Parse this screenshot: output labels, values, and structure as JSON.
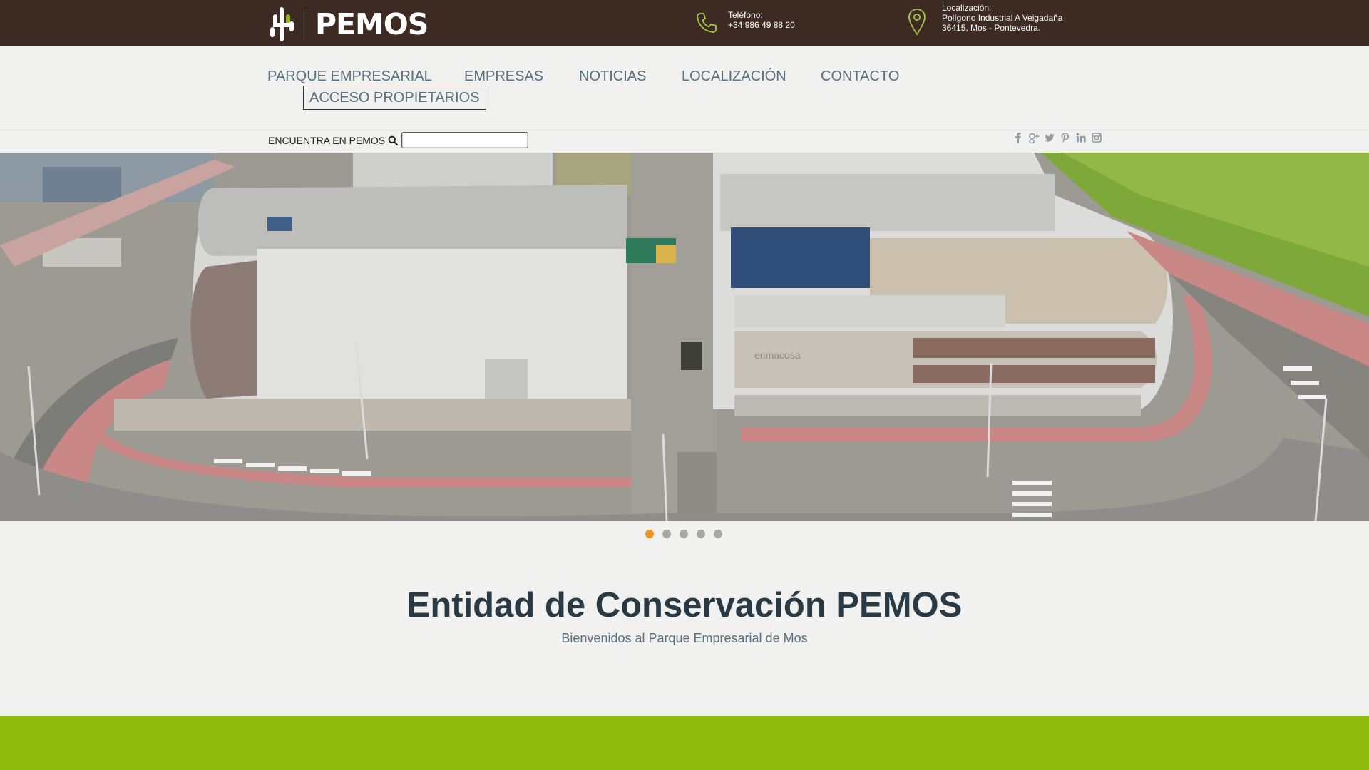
{
  "header": {
    "brand": "PEMOS",
    "phone_label": "Teléfono:",
    "phone_number": "+34 986 49 88 20",
    "location_label": "Localización:",
    "location_line1": "Polígono Industrial A Veigadaña",
    "location_line2": "36415, Mos - Pontevedra."
  },
  "nav": {
    "items": [
      {
        "label": "PARQUE EMPRESARIAL"
      },
      {
        "label": "EMPRESAS"
      },
      {
        "label": "NOTICIAS"
      },
      {
        "label": "LOCALIZACIÓN"
      },
      {
        "label": "CONTACTO"
      }
    ],
    "access_label": "ACCESO PROPIETARIOS"
  },
  "search": {
    "label": "ENCUENTRA EN PEMOS",
    "value": ""
  },
  "social": [
    "facebook-icon",
    "google-plus-icon",
    "twitter-icon",
    "pinterest-icon",
    "linkedin-icon",
    "instagram-icon"
  ],
  "hero": {
    "sign_text": "enmacosa",
    "slides_total": 5,
    "active_slide": 1
  },
  "main": {
    "title": "Entidad de Conservación PEMOS",
    "subtitle": "Bienvenidos al Parque Empresarial de Mos"
  },
  "colors": {
    "topbar": "#3d2a23",
    "accent_green": "#8fbc0e",
    "active_dot": "#f3931f",
    "nav_text": "#596e7e"
  }
}
